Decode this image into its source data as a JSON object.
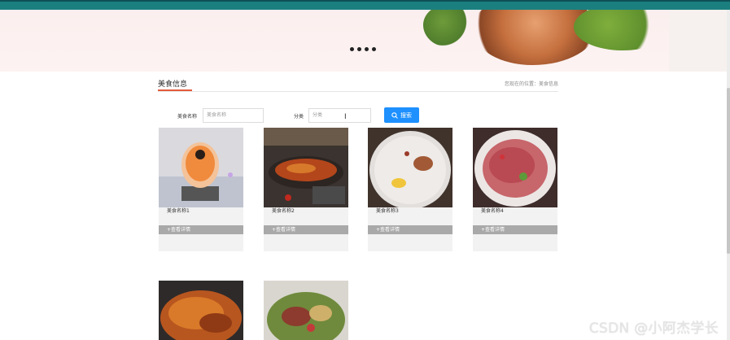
{
  "banner": {
    "carousel_dots": 4
  },
  "section": {
    "title": "美食信息",
    "breadcrumb": "您现在的位置：美食信息"
  },
  "filters": {
    "name_label": "美食名称",
    "name_placeholder": "美食名称",
    "category_label": "分类",
    "category_value": "分类",
    "search_label": "搜索"
  },
  "foods": [
    {
      "name": "美食名称1",
      "detail_label": "+查看详情"
    },
    {
      "name": "美食名称2",
      "detail_label": "+查看详情"
    },
    {
      "name": "美食名称3",
      "detail_label": "+查看详情"
    },
    {
      "name": "美食名称4",
      "detail_label": "+查看详情"
    }
  ],
  "watermark": "CSDN @小阿杰学长",
  "colors": {
    "accent": "#1e90ff",
    "header": "#1b7f7f",
    "underline": "#e25b3a"
  }
}
